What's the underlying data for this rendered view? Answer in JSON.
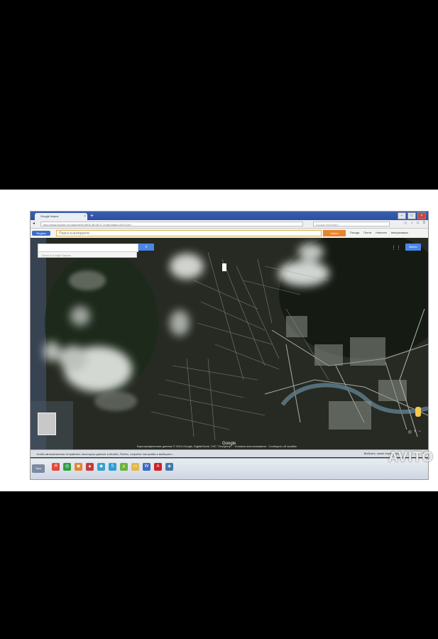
{
  "browser": {
    "tab_title": "Google Карты",
    "new_tab_symbol": "+",
    "window_buttons": [
      "–",
      "□",
      "×"
    ],
    "url": "http://www.google.ru/maps/@55.6805,38.0672,2148m/data=!3m1!1e3",
    "search_placeholder": "Google (Rambler)",
    "nav_icons": [
      "back-icon",
      "forward-icon",
      "reload-icon",
      "home-icon",
      "download-icon",
      "menu-icon"
    ]
  },
  "yandex_bar": {
    "logo": "Яндекс",
    "search_placeholder": "Поиск в интернете",
    "find_button": "Найти",
    "links": [
      "Погода",
      "Почта",
      "Новости",
      "Авторизация"
    ]
  },
  "map": {
    "search_button_icon": "search-icon",
    "suggestion": "Поиск в Google Картах",
    "signin_label": "Войти",
    "logo": "Google",
    "attribution": "Картографические данные © 2014 Google, DigitalGlobe, ГИС \"ГеоЦентр\" · Условия использования · Сообщить об ошибке"
  },
  "notification": {
    "text": "Чтобы автоматически отправлять некоторые данные в Mozilla, Firefox, откройте настройки и выберите...",
    "button": "Выбрать, какие параметры"
  },
  "taskbar": {
    "start_label": "Пуск",
    "apps": [
      {
        "icon": "yandex-icon",
        "color": "#e5463a",
        "glyph": "Я"
      },
      {
        "icon": "chrome-icon",
        "color": "#2f9e44",
        "glyph": "◎"
      },
      {
        "icon": "firefox-icon",
        "color": "#e8832e",
        "glyph": "◉"
      },
      {
        "icon": "shield-icon",
        "color": "#c43b3b",
        "glyph": "▲"
      },
      {
        "icon": "media-icon",
        "color": "#3aa0d0",
        "glyph": "◆"
      },
      {
        "icon": "skype-icon",
        "color": "#2a9fd8",
        "glyph": "S"
      },
      {
        "icon": "utorrent-icon",
        "color": "#6bb23a",
        "glyph": "µ"
      },
      {
        "icon": "folder-icon",
        "color": "#e1b84a",
        "glyph": "▭"
      },
      {
        "icon": "word-icon",
        "color": "#3b6cc4",
        "glyph": "W"
      },
      {
        "icon": "acrobat-icon",
        "color": "#c22",
        "glyph": "A"
      },
      {
        "icon": "photo-icon",
        "color": "#4477aa",
        "glyph": "◈"
      }
    ]
  },
  "watermark": "AVITO"
}
